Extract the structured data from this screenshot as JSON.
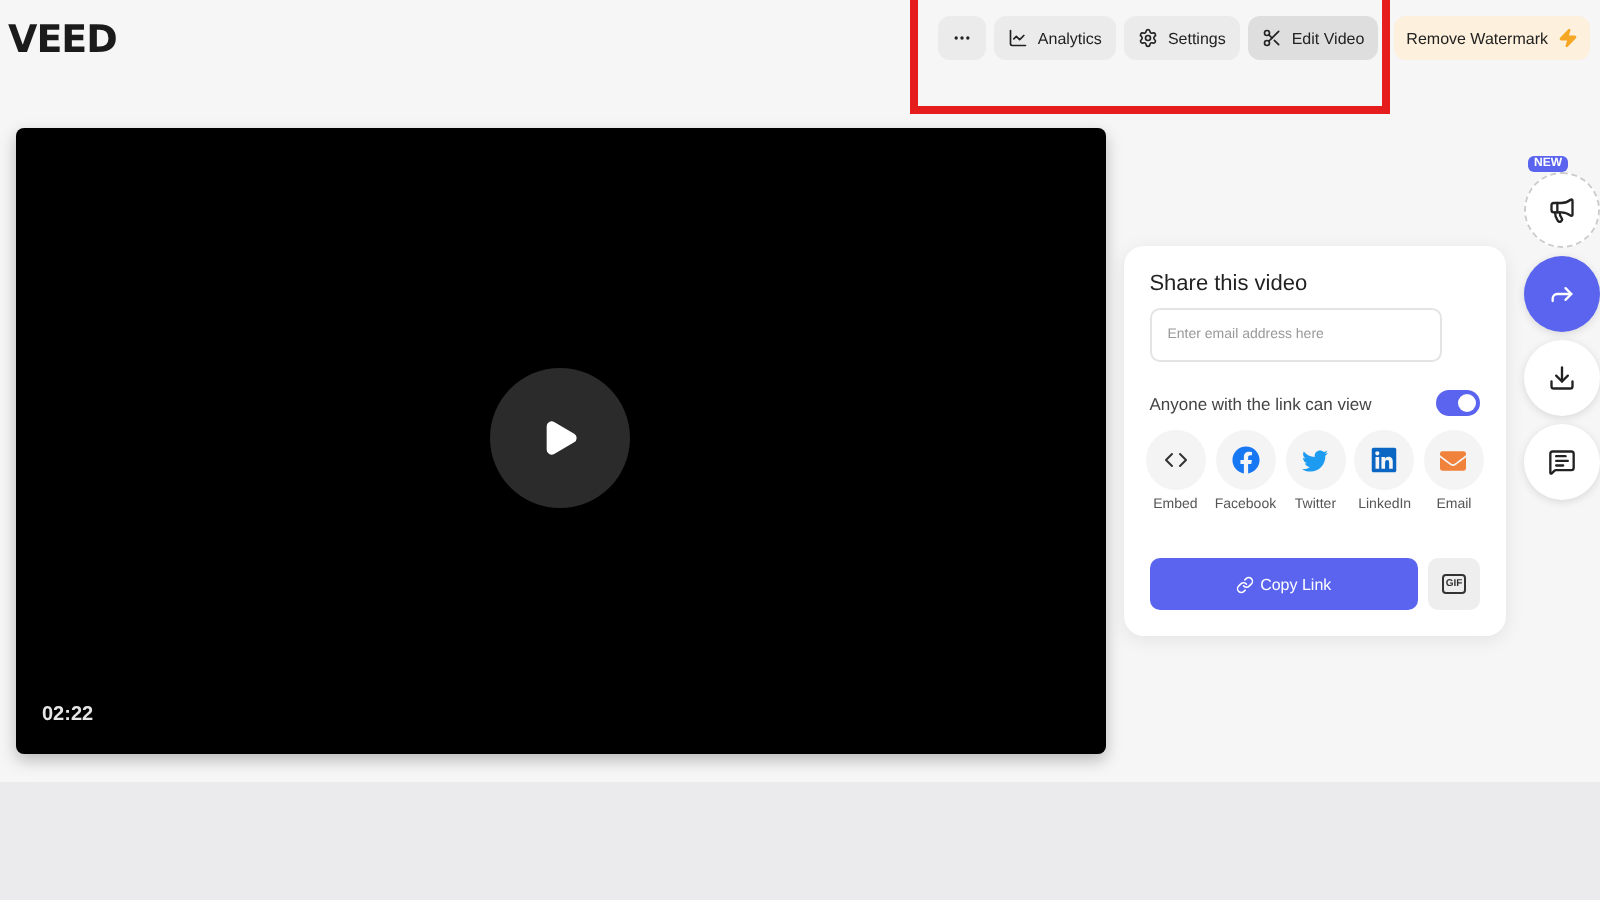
{
  "logo": "VEED",
  "actions": [
    {
      "kind": "more",
      "selected": false
    },
    {
      "kind": "analytics",
      "label": "Analytics",
      "selected": false
    },
    {
      "kind": "settings",
      "label": "Settings",
      "selected": false
    },
    {
      "kind": "edit",
      "label": "Edit Video",
      "selected": true
    },
    {
      "kind": "upgrade",
      "label": "Remove Watermark",
      "selected": false
    }
  ],
  "video": {
    "duration": "02:22"
  },
  "share": {
    "title": "Share this video",
    "email": {
      "placeholder": "Enter email address here"
    },
    "link_access": {
      "label": "Anyone with the link can view",
      "on": true
    },
    "targets": [
      {
        "kind": "embed",
        "label": "Embed"
      },
      {
        "kind": "facebook",
        "label": "Facebook"
      },
      {
        "kind": "twitter",
        "label": "Twitter"
      },
      {
        "kind": "linkedin",
        "label": "LinkedIn"
      },
      {
        "kind": "email",
        "label": "Email"
      }
    ],
    "copy_button": "Copy Link",
    "gif_button": "GIF"
  },
  "rail": [
    {
      "kind": "announce",
      "badge": "NEW",
      "selected": false
    },
    {
      "kind": "share",
      "selected": true
    },
    {
      "kind": "download",
      "selected": false
    },
    {
      "kind": "comment",
      "selected": false
    }
  ]
}
